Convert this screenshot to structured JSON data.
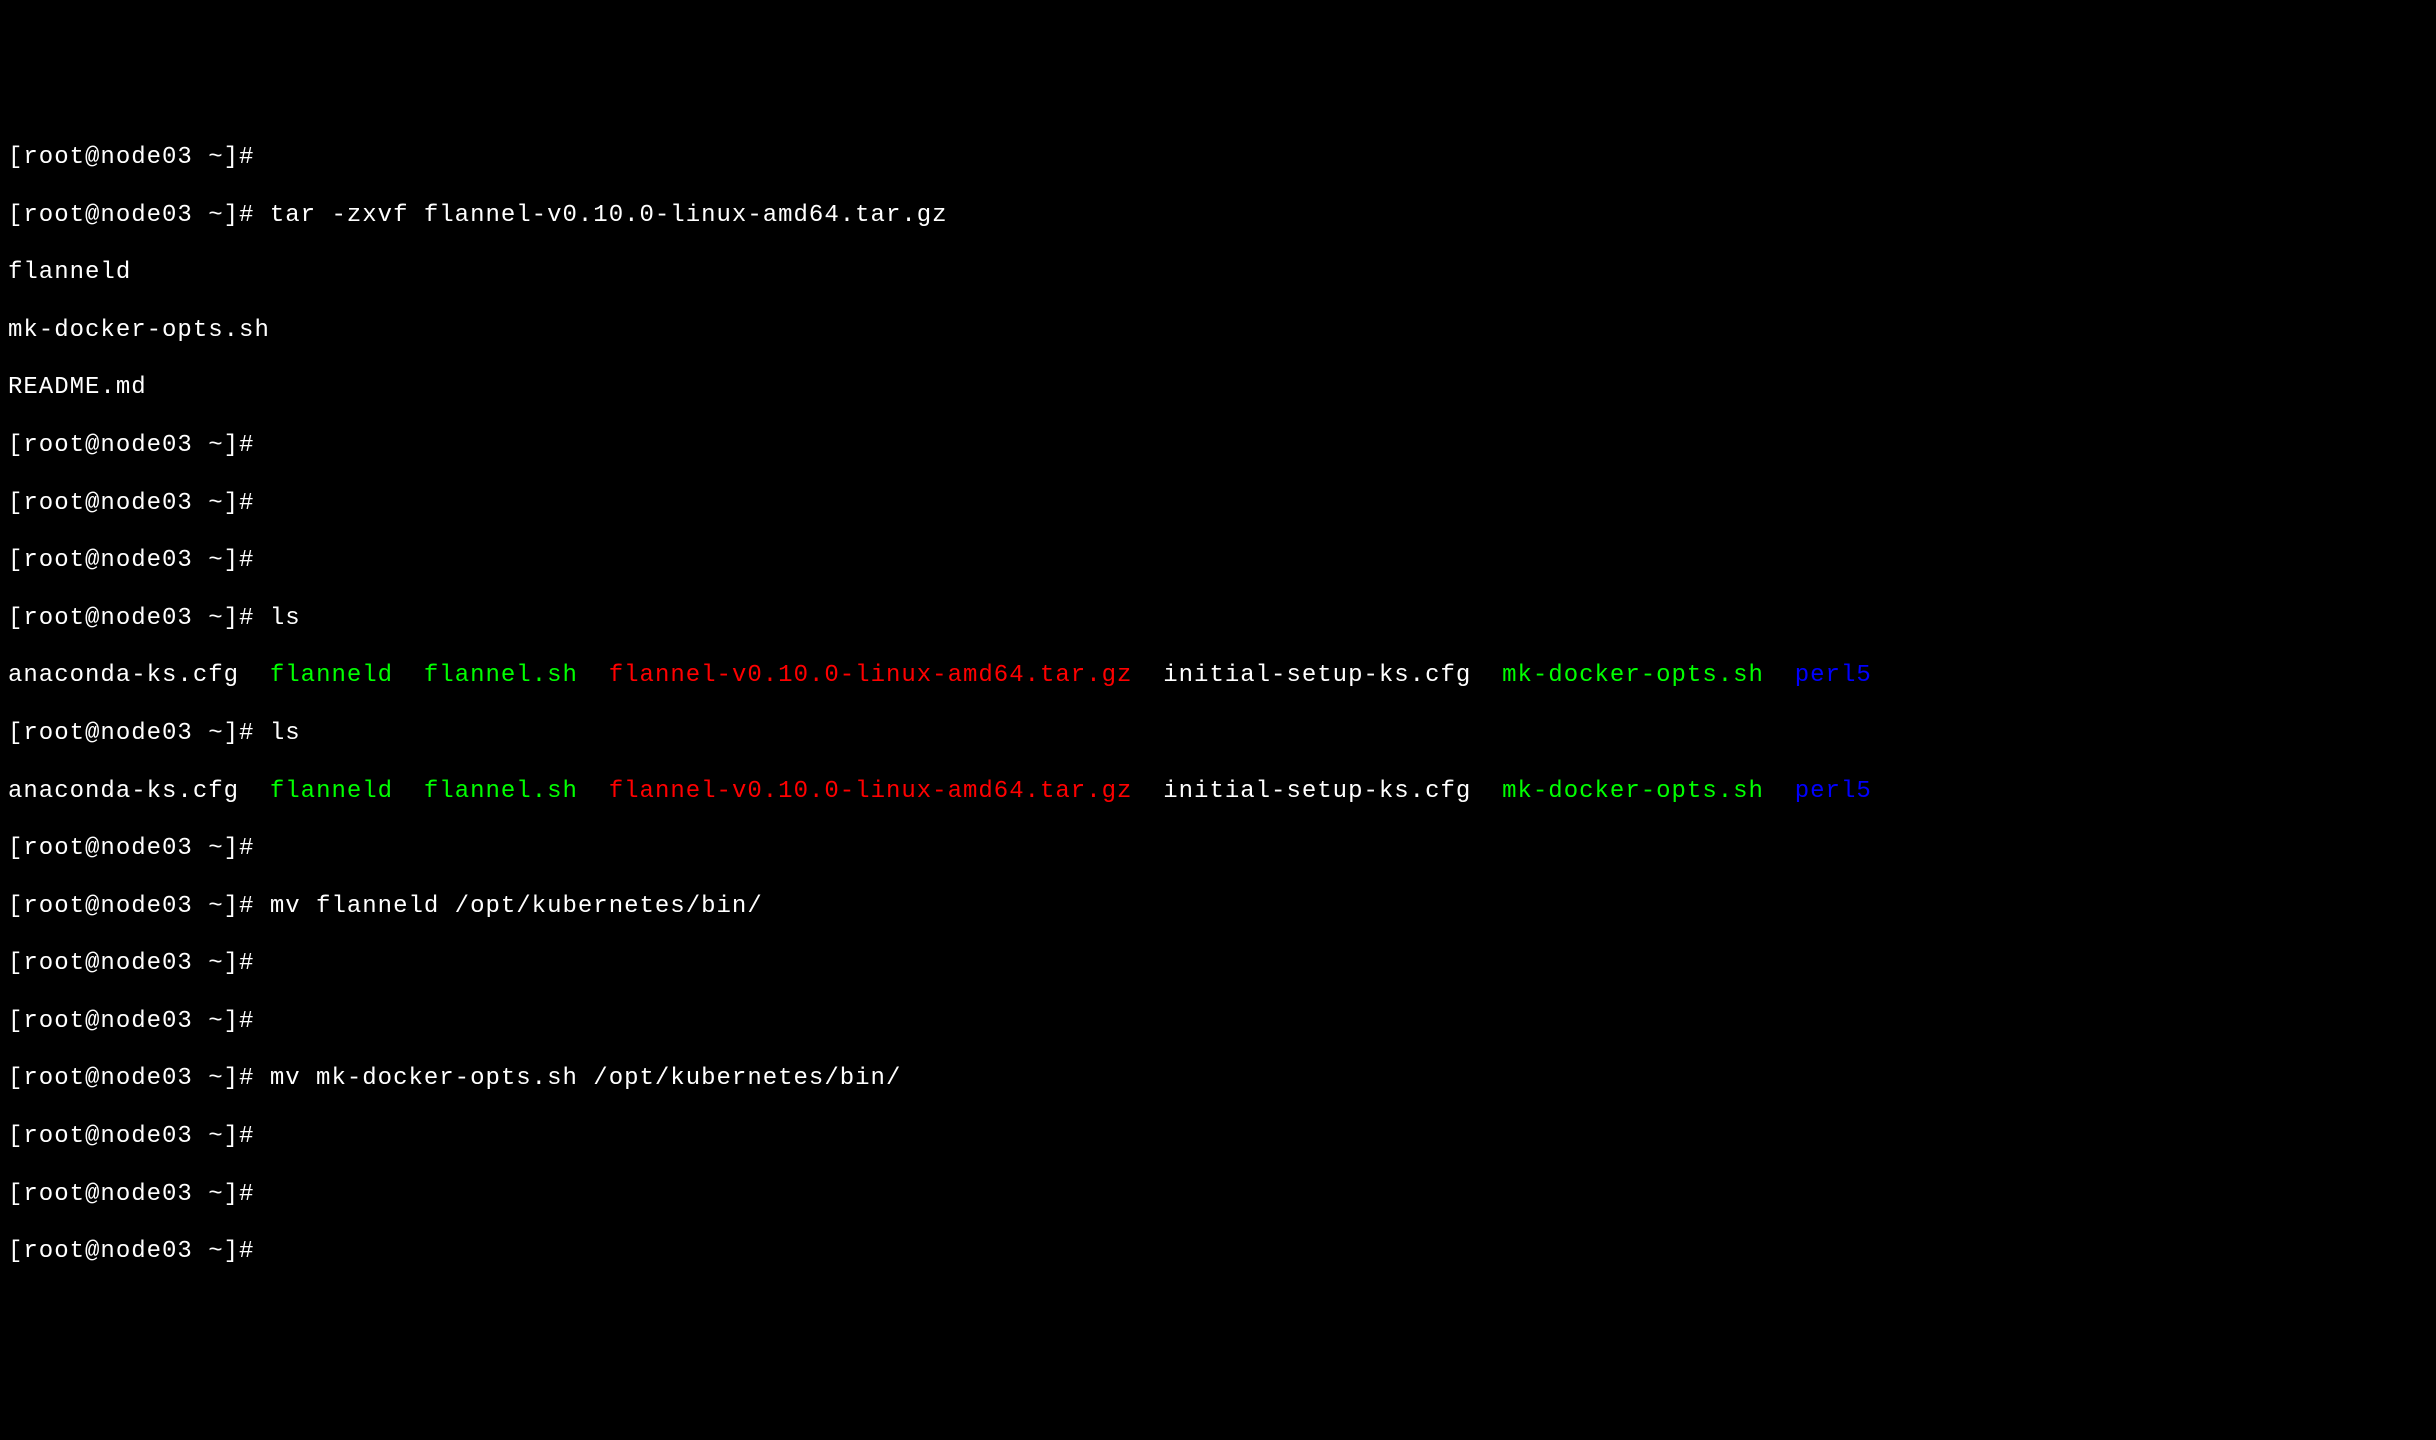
{
  "prompt": "[root@node03 ~]#",
  "commands": {
    "tar": "tar -zxvf flannel-v0.10.0-linux-amd64.tar.gz",
    "ls": "ls",
    "mv1": "mv flanneld /opt/kubernetes/bin/",
    "mv2": "mv mk-docker-opts.sh /opt/kubernetes/bin/"
  },
  "tar_output": {
    "line1": "flanneld",
    "line2": "mk-docker-opts.sh",
    "line3": "README.md"
  },
  "ls_output": {
    "items": [
      {
        "name": "anaconda-ks.cfg",
        "color": "white"
      },
      {
        "name": "flanneld",
        "color": "green"
      },
      {
        "name": "flannel.sh",
        "color": "green"
      },
      {
        "name": "flannel-v0.10.0-linux-amd64.tar.gz",
        "color": "red"
      },
      {
        "name": "initial-setup-ks.cfg",
        "color": "white"
      },
      {
        "name": "mk-docker-opts.sh",
        "color": "green"
      },
      {
        "name": "perl5",
        "color": "blue"
      }
    ]
  }
}
